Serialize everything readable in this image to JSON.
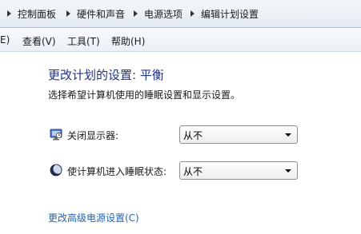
{
  "breadcrumb": [
    {
      "label": "控制面板"
    },
    {
      "label": "硬件和声音"
    },
    {
      "label": "电源选项"
    },
    {
      "label": "编辑计划设置"
    }
  ],
  "menubar": {
    "edit_partial": "E)",
    "view": "查看(V)",
    "tools": "工具(T)",
    "help": "帮助(H)"
  },
  "page": {
    "title": "更改计划的设置: 平衡",
    "subtitle": "选择希望计算机使用的睡眠设置和显示设置。"
  },
  "settings": {
    "display_off": {
      "label": "关闭显示器:",
      "icon": "display-off-icon",
      "value": "从不"
    },
    "sleep": {
      "label": "使计算机进入睡眠状态:",
      "icon": "moon-sleep-icon",
      "value": "从不"
    }
  },
  "advanced_link": "更改高级电源设置(C)"
}
